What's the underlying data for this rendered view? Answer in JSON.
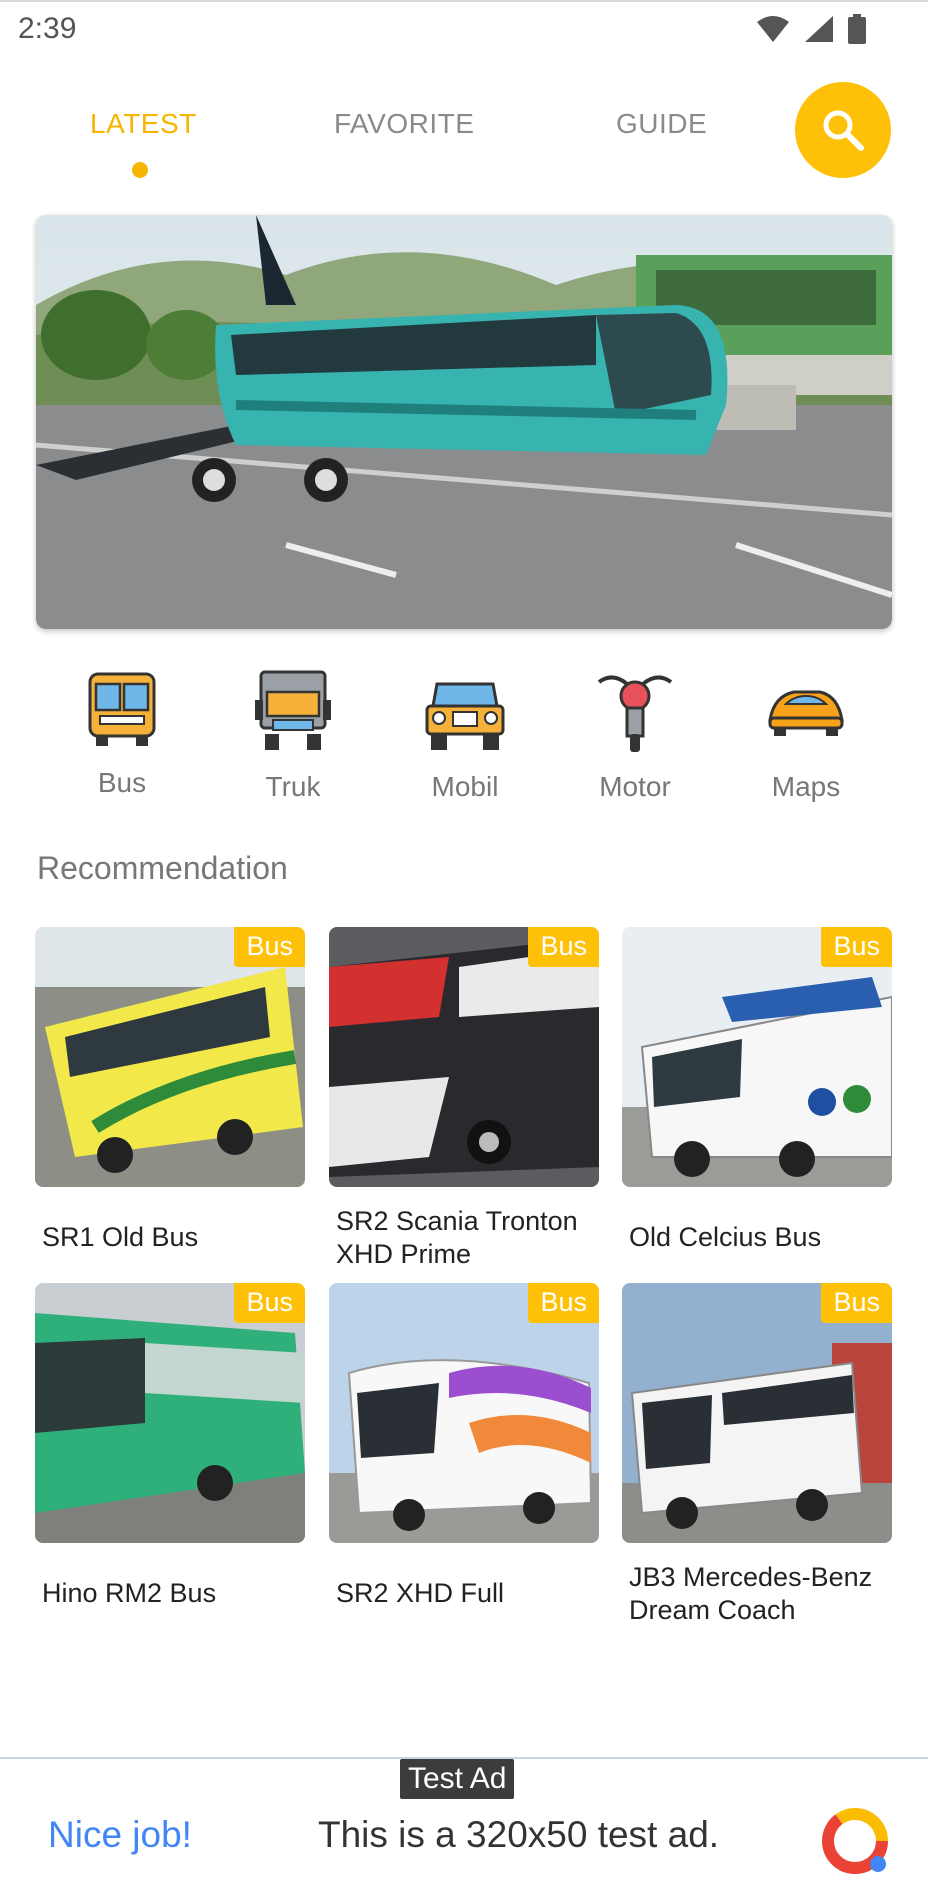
{
  "status_bar": {
    "time": "2:39",
    "icons": [
      "wifi-icon",
      "signal-icon",
      "battery-icon"
    ]
  },
  "tabs": [
    {
      "label": "LATEST",
      "active": true
    },
    {
      "label": "FAVORITE",
      "active": false
    },
    {
      "label": "GUIDE",
      "active": false
    }
  ],
  "search": {
    "icon": "search-icon"
  },
  "categories": [
    {
      "label": "Bus",
      "icon": "bus-icon"
    },
    {
      "label": "Truk",
      "icon": "truck-icon"
    },
    {
      "label": "Mobil",
      "icon": "jeep-icon"
    },
    {
      "label": "Motor",
      "icon": "motorcycle-icon"
    },
    {
      "label": "Maps",
      "icon": "sports-car-icon"
    }
  ],
  "recommendation": {
    "title": "Recommendation",
    "items": [
      {
        "title_lines": [
          "SR1 Old Bus"
        ],
        "badge": "Bus"
      },
      {
        "title_lines": [
          "SR2 Scania Tronton",
          "XHD Prime"
        ],
        "badge": "Bus"
      },
      {
        "title_lines": [
          "Old Celcius Bus"
        ],
        "badge": "Bus"
      },
      {
        "title_lines": [
          "Hino RM2 Bus"
        ],
        "badge": "Bus"
      },
      {
        "title_lines": [
          "SR2 XHD Full"
        ],
        "badge": "Bus"
      },
      {
        "title_lines": [
          "JB3 Mercedes-Benz",
          "Dream Coach"
        ],
        "badge": "Bus"
      }
    ]
  },
  "ad": {
    "tag": "Test Ad",
    "nice": "Nice job!",
    "text": "This is a 320x50 test ad."
  },
  "colors": {
    "accent": "#ffc107",
    "tab_active": "#f7b500",
    "ad_blue": "#4285f4"
  }
}
